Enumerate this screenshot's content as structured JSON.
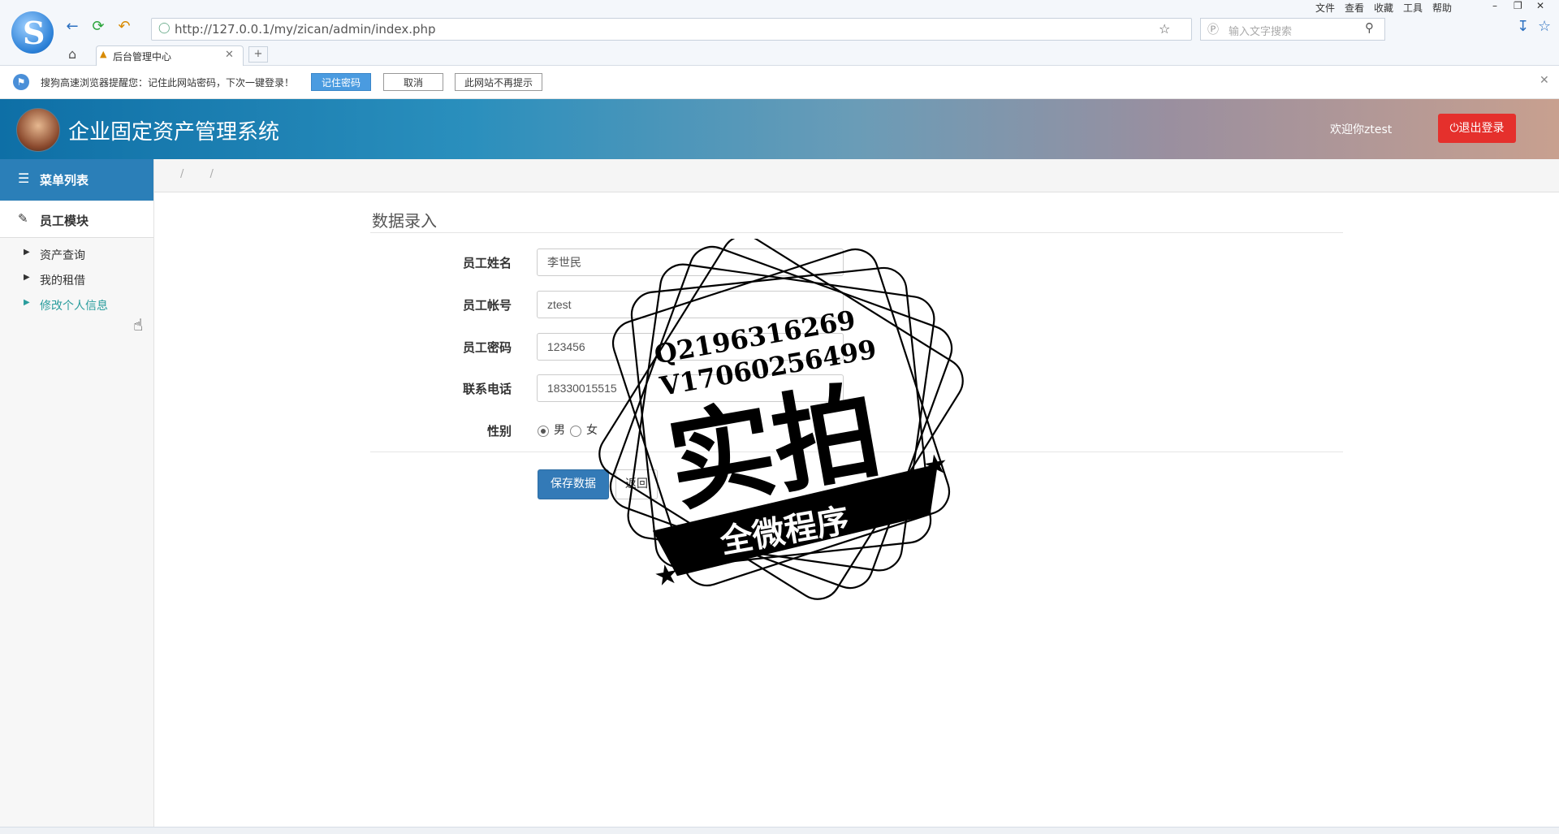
{
  "browser": {
    "url": "http://127.0.0.1/my/zican/admin/index.php",
    "search_placeholder": "输入文字搜索",
    "tab_title": "后台管理中心",
    "menu": [
      "文件",
      "查看",
      "收藏",
      "工具",
      "帮助"
    ]
  },
  "infobar": {
    "message": "搜狗高速浏览器提醒您：记住此网站密码，下次一键登录！",
    "remember_label": "记住密码",
    "cancel_label": "取消",
    "never_label": "此网站不再提示"
  },
  "header": {
    "title": "企业固定资产管理系统",
    "welcome": "欢迎你ztest",
    "logout_label": "退出登录"
  },
  "sidebar": {
    "menu_title": "菜单列表",
    "module_title": "员工模块",
    "items": [
      {
        "label": "资产查询"
      },
      {
        "label": "我的租借"
      },
      {
        "label": "修改个人信息"
      }
    ]
  },
  "breadcrumb": "/ /",
  "form": {
    "title": "数据录入",
    "fields": [
      {
        "label": "员工姓名",
        "value": "李世民"
      },
      {
        "label": "员工帐号",
        "value": "ztest"
      },
      {
        "label": "员工密码",
        "value": "123456"
      },
      {
        "label": "联系电话",
        "value": "18330015515"
      }
    ],
    "gender_label": "性别",
    "gender_options": [
      "男",
      "女"
    ],
    "gender_selected": "男",
    "save_label": "保存数据",
    "back_label": "返回"
  },
  "watermark": {
    "line1": "Q2196316269",
    "line2": "V17060256499",
    "main": "实拍",
    "banner": "全微程序"
  },
  "colors": {
    "accent": "#2b7fb8",
    "logout": "#e5302c",
    "primary_button": "#337ab7",
    "active_link": "#2a9d9d"
  }
}
